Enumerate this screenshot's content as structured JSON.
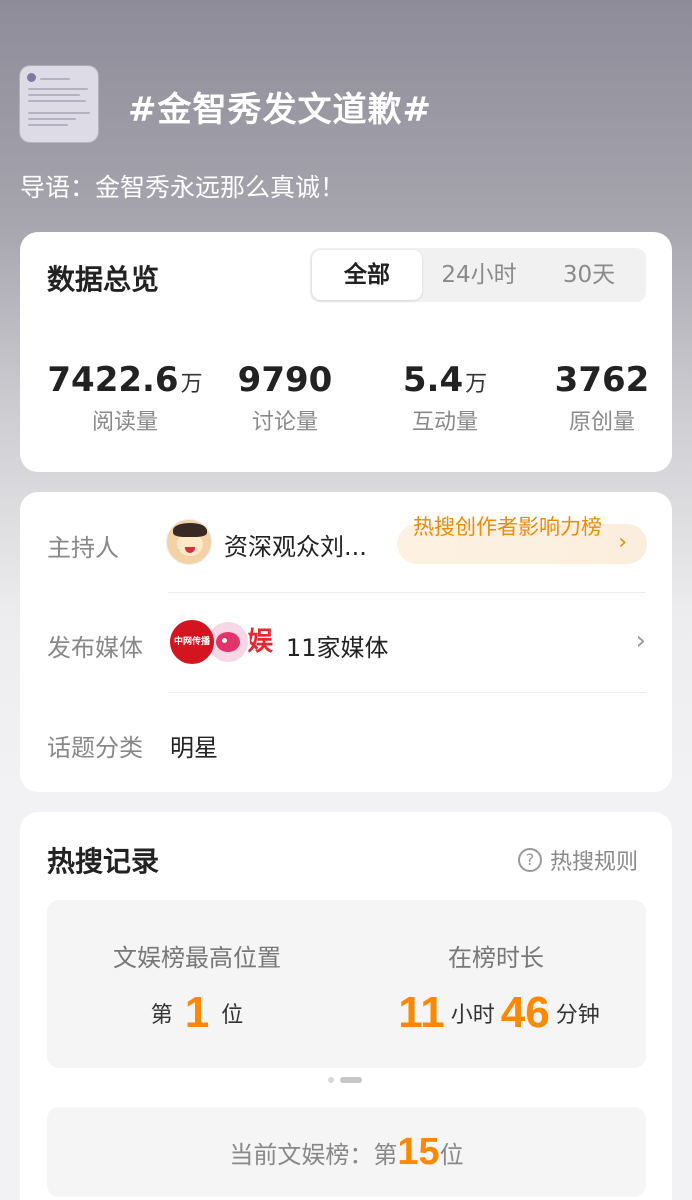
{
  "header": {
    "topic_title": "#金智秀发文道歉#",
    "intro": "导语：金智秀永远那么真诚！"
  },
  "data_overview": {
    "title": "数据总览",
    "tabs": [
      {
        "label": "全部",
        "active": true
      },
      {
        "label": "24小时",
        "active": false
      },
      {
        "label": "30天",
        "active": false
      }
    ],
    "stats": [
      {
        "value": "7422.6",
        "unit": "万",
        "label": "阅读量"
      },
      {
        "value": "9790",
        "unit": "",
        "label": "讨论量"
      },
      {
        "value": "5.4",
        "unit": "万",
        "label": "互动量"
      },
      {
        "value": "3762",
        "unit": "",
        "label": "原创量"
      }
    ]
  },
  "info": {
    "host_label": "主持人",
    "host_name": "资深观众刘...",
    "host_badge": "热搜创作者影响力榜",
    "media_label": "发布媒体",
    "media_logo_text": "中网传播",
    "media_logo_text_2": "娱",
    "media_count": "11家媒体",
    "category_label": "话题分类",
    "category_value": "明星"
  },
  "hot_record": {
    "title": "热搜记录",
    "rules_label": "热搜规则",
    "highest_label": "文娱榜最高位置",
    "highest_prefix": "第",
    "highest_value": "1",
    "highest_suffix": "位",
    "duration_label": "在榜时长",
    "duration_hours": "11",
    "duration_hours_unit": "小时",
    "duration_minutes": "46",
    "duration_minutes_unit": "分钟",
    "current_label": "当前文娱榜：第",
    "current_value": "15",
    "current_suffix": "位"
  },
  "colors": {
    "accent": "#ff8800",
    "badge_text": "#f08a0a"
  },
  "icons": [
    "topic-thumbnail",
    "question-circle-icon",
    "chevron-right-icon"
  ]
}
